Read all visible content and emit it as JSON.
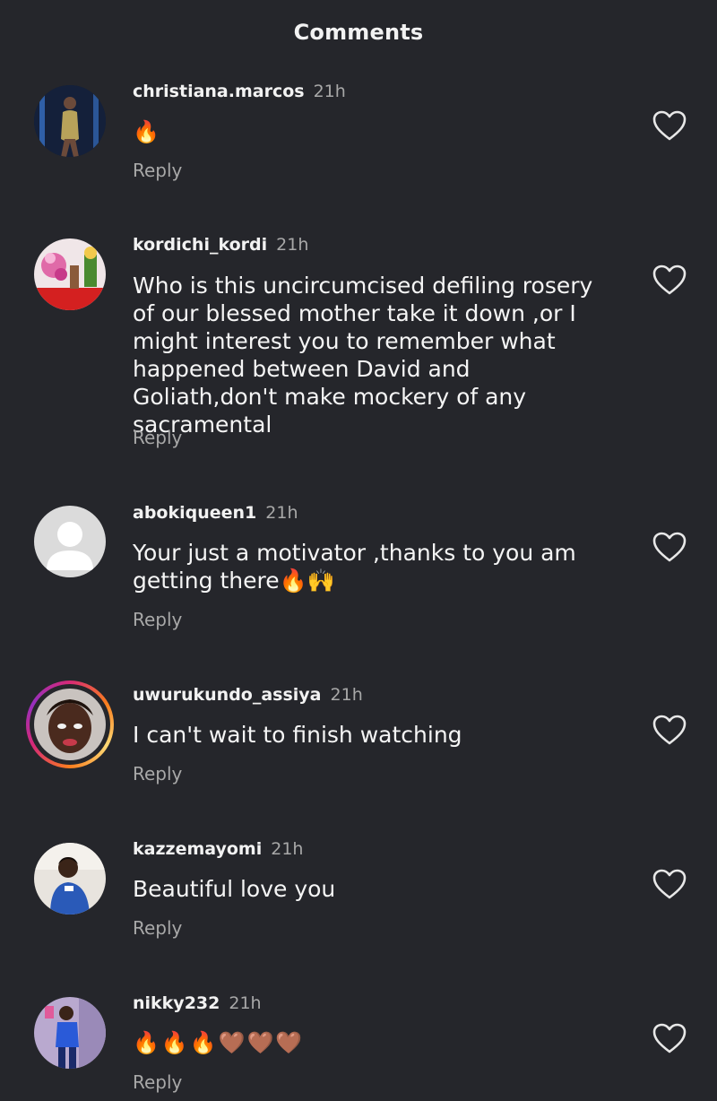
{
  "header": {
    "title": "Comments"
  },
  "reply_label": "Reply",
  "comments": [
    {
      "username": "christiana.marcos",
      "time": "21h",
      "text": "🔥"
    },
    {
      "username": "kordichi_kordi",
      "time": "21h",
      "text": "Who is this uncircumcised defiling rosery of our blessed mother take it down ,or I might interest you to remember what happened between David and Goliath,don't make mockery of any sacramental"
    },
    {
      "username": "abokiqueen1",
      "time": "21h",
      "text": "Your just a motivator ,thanks to you am getting there🔥🙌"
    },
    {
      "username": "uwurukundo_assiya",
      "time": "21h",
      "text": "I can't wait to finish watching"
    },
    {
      "username": "kazzemayomi",
      "time": "21h",
      "text": "Beautiful love you"
    },
    {
      "username": "nikky232",
      "time": "21h",
      "text": "🔥🔥🔥🤎🤎🤎"
    }
  ],
  "icons": {
    "like": "heart-outline-icon",
    "default_avatar": "person-placeholder-icon"
  },
  "colors": {
    "background": "#25262b",
    "secondary_text": "#a8a8a8",
    "primary_text": "#f2f2f2"
  }
}
